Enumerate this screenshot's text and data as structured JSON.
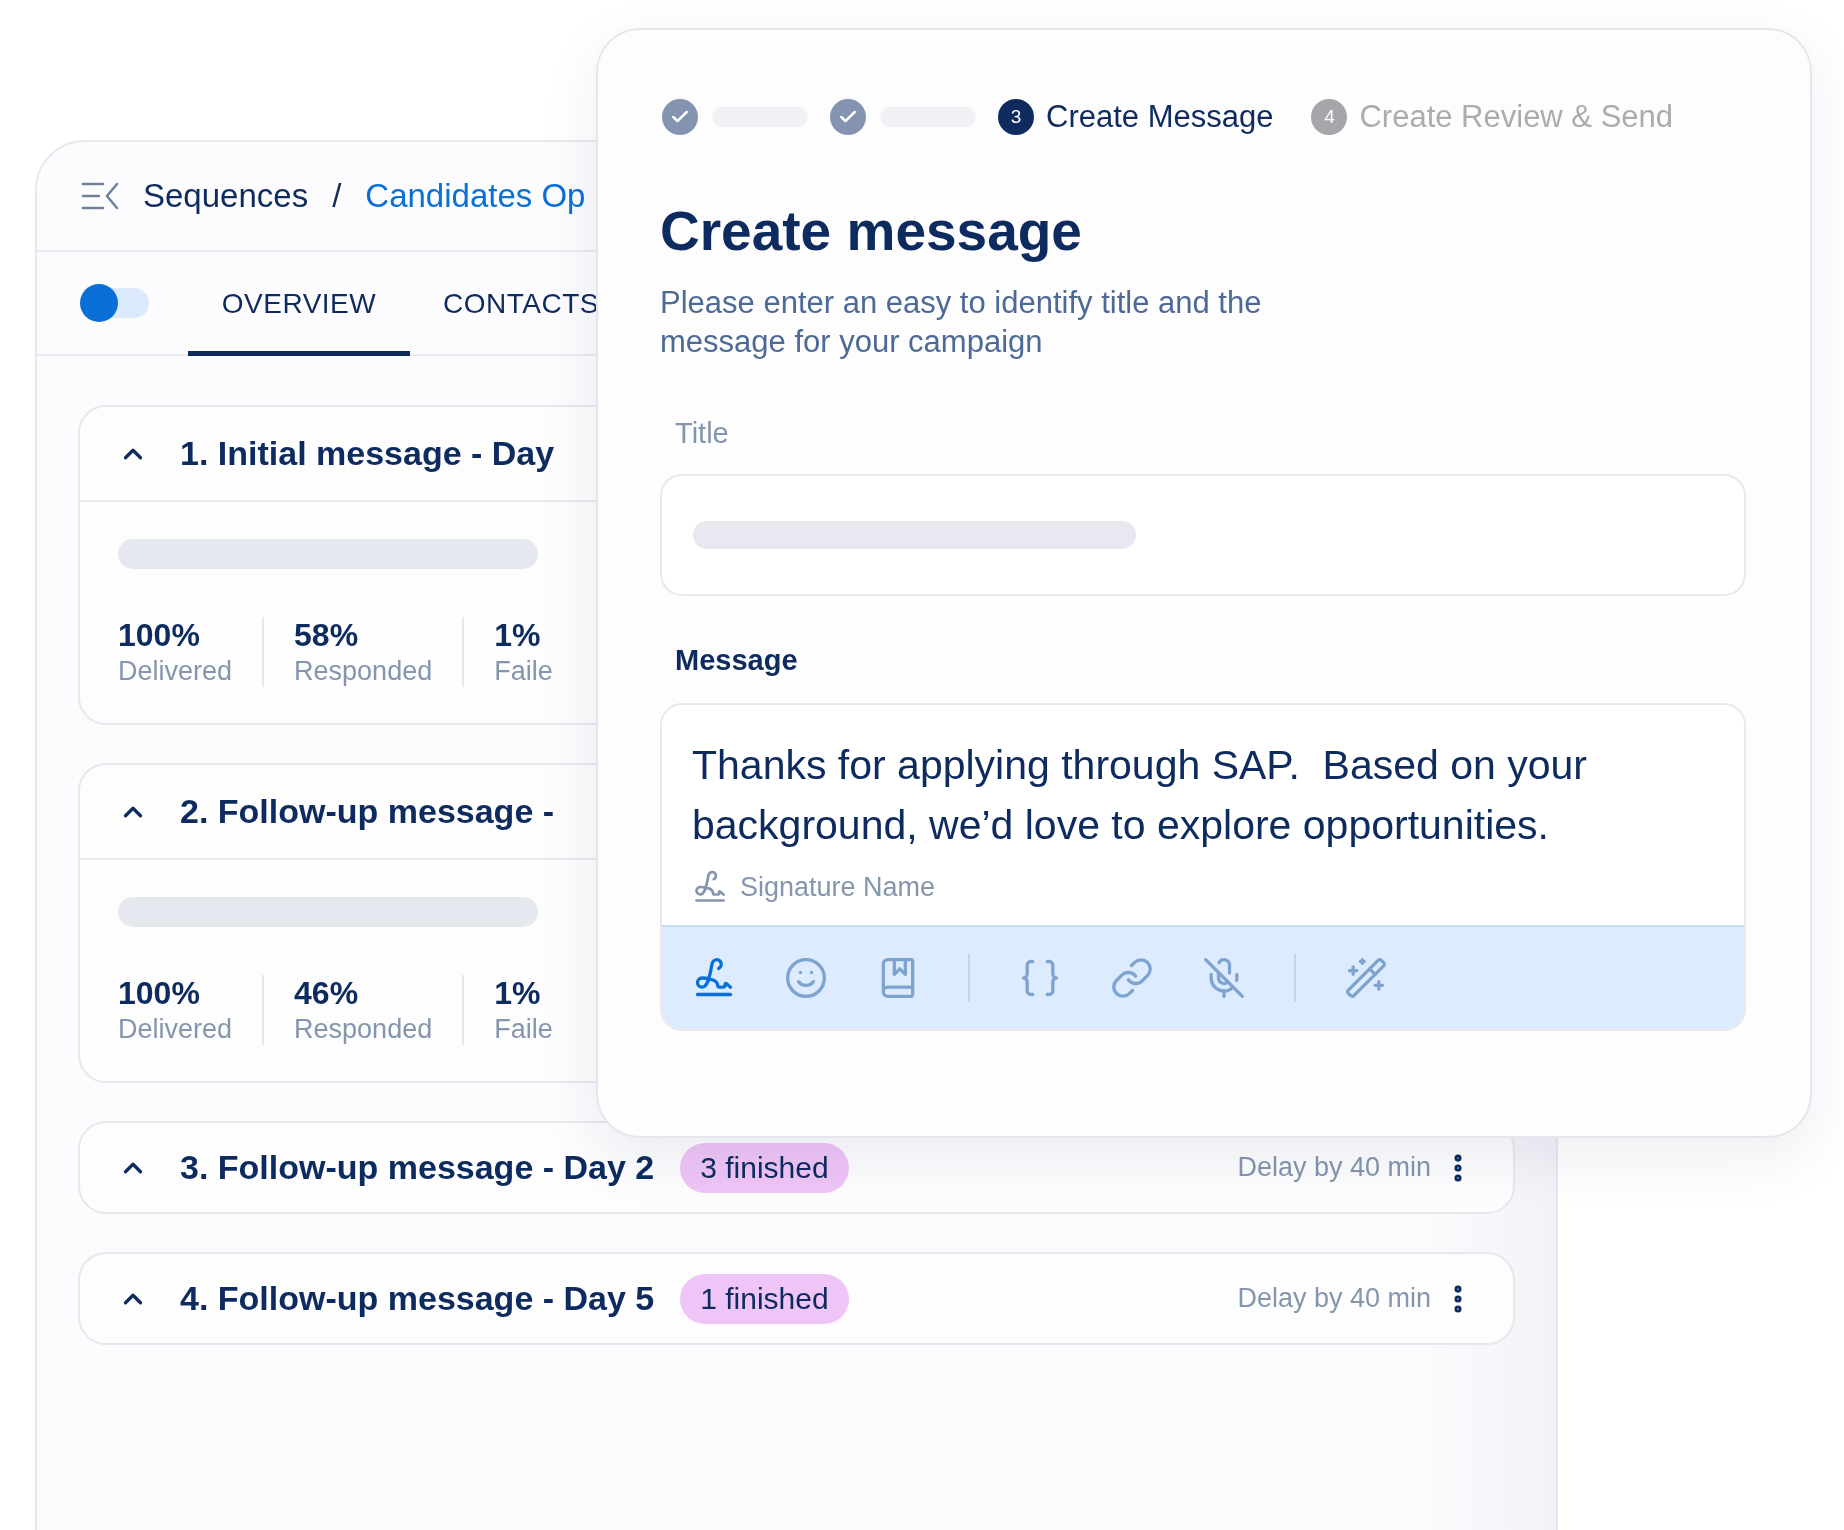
{
  "breadcrumb": {
    "root": "Sequences",
    "separator": "/",
    "current": "Candidates Op"
  },
  "toggle": {
    "on": false
  },
  "tabs": [
    {
      "label": "OVERVIEW",
      "selected": true
    },
    {
      "label": "CONTACTS",
      "selected": false
    }
  ],
  "cards": [
    {
      "title": "1. Initial message - Day",
      "expanded": true,
      "stats": [
        {
          "value": "100%",
          "label": "Delivered"
        },
        {
          "value": "58%",
          "label": "Responded"
        },
        {
          "value": "1%",
          "label": "Faile"
        }
      ]
    },
    {
      "title": "2. Follow-up message -",
      "expanded": true,
      "stats": [
        {
          "value": "100%",
          "label": "Delivered"
        },
        {
          "value": "46%",
          "label": "Responded"
        },
        {
          "value": "1%",
          "label": "Faile"
        }
      ]
    },
    {
      "title": "3. Follow-up message - Day 2",
      "expanded": true,
      "badge": "3 finished",
      "delay": "Delay by 40 min"
    },
    {
      "title": "4. Follow-up message - Day 5",
      "expanded": true,
      "badge": "1 finished",
      "delay": "Delay by 40 min"
    }
  ],
  "modal": {
    "steps": [
      {
        "kind": "completed"
      },
      {
        "kind": "completed"
      },
      {
        "kind": "numbered",
        "selected": true,
        "number": "3",
        "label": "Create Message"
      },
      {
        "kind": "numbered",
        "selected": false,
        "number": "4",
        "label": "Create Review & Send"
      }
    ],
    "heading": "Create message",
    "subtitle": "Please enter an easy to identify title and the message for your campaign",
    "title_field": {
      "label": "Title"
    },
    "message_field": {
      "label": "Message",
      "value": "Thanks for applying through SAP.  Based on your background, we’d love to explore opportunities.",
      "signature": "Signature Name"
    },
    "toolbar": [
      {
        "kind": "signature",
        "selected": true
      },
      {
        "kind": "emoji",
        "selected": false
      },
      {
        "kind": "book",
        "selected": false
      },
      {
        "kind": "separator"
      },
      {
        "kind": "braces",
        "selected": false
      },
      {
        "kind": "link",
        "selected": false
      },
      {
        "kind": "mic-off",
        "selected": false
      },
      {
        "kind": "separator"
      },
      {
        "kind": "magic",
        "selected": false
      }
    ]
  }
}
